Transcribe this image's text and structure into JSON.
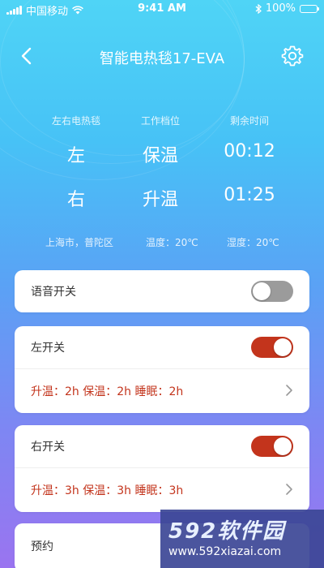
{
  "status_bar": {
    "carrier": "中国移动",
    "time": "9:41 AM",
    "battery": "100%"
  },
  "nav": {
    "title": "智能电热毯17-EVA"
  },
  "info": {
    "headers": [
      "左右电热毯",
      "工作档位",
      "剩余时间"
    ],
    "rows": [
      {
        "side": "左",
        "mode": "保温",
        "remaining": "00:12"
      },
      {
        "side": "右",
        "mode": "升温",
        "remaining": "01:25"
      }
    ],
    "location": "上海市，普陀区",
    "temperature": "温度：20℃",
    "humidity": "湿度：20℃"
  },
  "voice": {
    "label": "语音开关",
    "on": false
  },
  "left": {
    "label": "左开关",
    "on": true,
    "schedule": "升温：2h   保温：2h   睡眠：2h"
  },
  "right": {
    "label": "右开关",
    "on": true,
    "schedule": "升温：3h   保温：3h   睡眠：3h"
  },
  "appointment": {
    "label": "预约"
  },
  "watermark": {
    "logo": "592软件园",
    "url": "www.592xiazai.com"
  },
  "colors": {
    "accent": "#c3341c",
    "toggle_off": "#9b9b9b",
    "bg_top": "#4fd4f6",
    "bg_bottom": "#9a74f0"
  }
}
